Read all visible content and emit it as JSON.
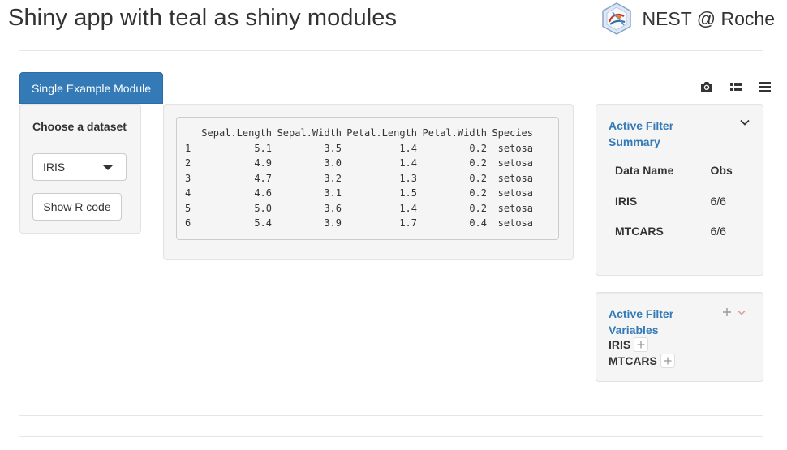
{
  "header": {
    "title": "Shiny app with teal as shiny modules",
    "brand": "NEST @ Roche",
    "logo_icon": "nest-hex-logo"
  },
  "tabs": [
    {
      "label": "Single Example Module",
      "active": true,
      "color": "#337ab7"
    }
  ],
  "toolbar": {
    "icons": [
      "camera-icon",
      "grid-icon",
      "menu-icon"
    ]
  },
  "encoding": {
    "dataset_label": "Choose a dataset",
    "dataset_selected": "IRIS",
    "show_code_label": "Show R code"
  },
  "output": {
    "columns": [
      "Sepal.Length",
      "Sepal.Width",
      "Petal.Length",
      "Petal.Width",
      "Species"
    ],
    "rows": [
      [
        "1",
        "5.1",
        "3.5",
        "1.4",
        "0.2",
        "setosa"
      ],
      [
        "2",
        "4.9",
        "3.0",
        "1.4",
        "0.2",
        "setosa"
      ],
      [
        "3",
        "4.7",
        "3.2",
        "1.3",
        "0.2",
        "setosa"
      ],
      [
        "4",
        "4.6",
        "3.1",
        "1.5",
        "0.2",
        "setosa"
      ],
      [
        "5",
        "5.0",
        "3.6",
        "1.4",
        "0.2",
        "setosa"
      ],
      [
        "6",
        "5.4",
        "3.9",
        "1.7",
        "0.4",
        "setosa"
      ]
    ]
  },
  "filter_summary": {
    "title": "Active Filter Summary",
    "columns": [
      "Data Name",
      "Obs"
    ],
    "rows": [
      [
        "IRIS",
        "6/6"
      ],
      [
        "MTCARS",
        "6/6"
      ]
    ]
  },
  "filter_variables": {
    "title": "Active Filter Variables",
    "datasets": [
      "IRIS",
      "MTCARS"
    ]
  },
  "colors": {
    "accent": "#337ab7",
    "panel_bg": "#f5f5f5",
    "chevron_muted": "#d9a0a0"
  }
}
